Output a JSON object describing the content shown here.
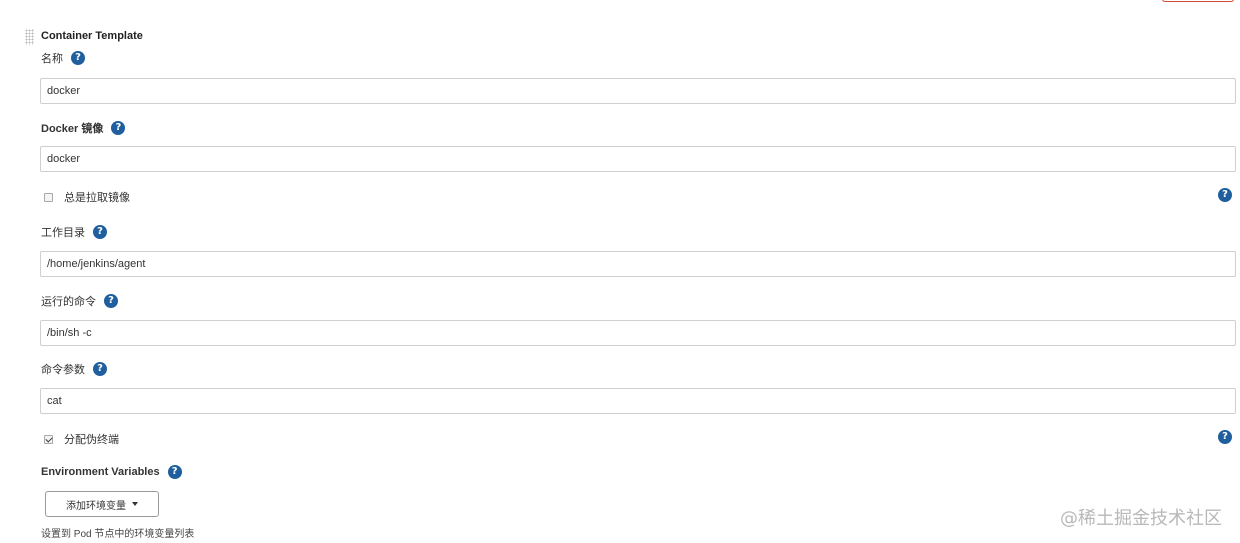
{
  "section": {
    "title": "Container Template"
  },
  "help_glyph": "?",
  "fields": {
    "name": {
      "label": "名称",
      "value": "docker"
    },
    "image": {
      "label": "Docker 镜像",
      "value": "docker"
    },
    "always_pull": {
      "label": "总是拉取镜像",
      "checked": false
    },
    "working_dir": {
      "label": "工作目录",
      "value": "/home/jenkins/agent"
    },
    "command": {
      "label": "运行的命令",
      "value": "/bin/sh -c"
    },
    "args": {
      "label": "命令参数",
      "value": "cat"
    },
    "tty": {
      "label": "分配伪终端",
      "checked": true
    }
  },
  "env": {
    "label": "Environment Variables",
    "add_button": "添加环境变量",
    "description": "设置到 Pod 节点中的环境变量列表"
  },
  "watermark": "@稀土掘金技术社区",
  "colors": {
    "help": "#1f5f9e",
    "border": "#cfcfcf",
    "danger": "#d24939"
  },
  "icons": [
    "drag-handle-icon",
    "help-icon",
    "checkbox",
    "caret-down-icon"
  ]
}
